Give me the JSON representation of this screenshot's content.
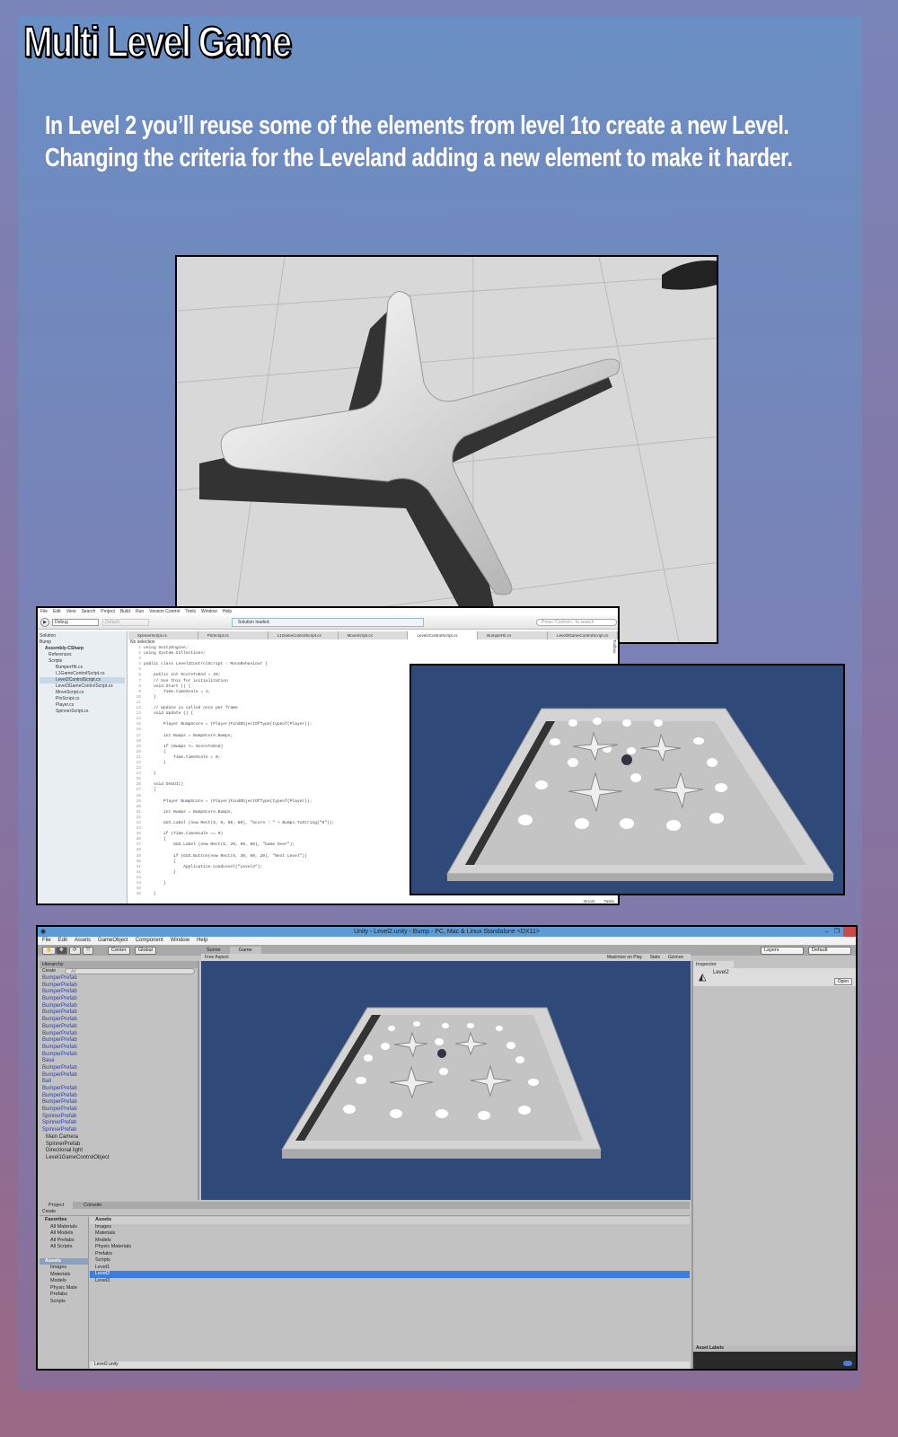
{
  "title": "Multi Level Game",
  "intro": "In Level 2 you’ll reuse some of the elements from level 1to create a new Level.  Changing the criteria for the Leveland adding a new element to make it harder.",
  "ide": {
    "menu": [
      "File",
      "Edit",
      "View",
      "Search",
      "Project",
      "Build",
      "Run",
      "Version Control",
      "Tools",
      "Window",
      "Help"
    ],
    "config": "Debug",
    "target": "Default",
    "status": "Solution loaded.",
    "search_placeholder": "Press 'Control+,' to search",
    "solution_label": "Solution",
    "no_selection": "No selection",
    "tree": [
      "Bump",
      "Assembly-CSharp",
      "References",
      "Scripts",
      "BumperHit.cs",
      "L1GameControlScript.cs",
      "Level2ControlScript.cs",
      "Level3GameControlScript.cs",
      "MoveScript.cs",
      "PinScript.cs",
      "Player.cs",
      "SpinnerScript.cs"
    ],
    "tabs": [
      "SpinnerScript.cs",
      "PinScript.cs",
      "L1GameControlScript.cs",
      "MoveScript.cs",
      "Level2ControlScript.cs",
      "BumperHit.cs",
      "Level3GameControlScript.cs"
    ],
    "side_tab": "Toolbox",
    "bottom": [
      "Errors",
      "Tasks"
    ],
    "code": [
      "using UnityEngine;",
      "using System.Collections;",
      "",
      "public class Level2ControlScript : MonoBehaviour {",
      "",
      "    public int ScoreToEnd = 20;",
      "    // Use this for initialization",
      "    void Start () {",
      "        Time.timeScale = 1;",
      "    }",
      "",
      "    // Update is called once per frame",
      "    void Update () {",
      "",
      "        Player BumpScore = (Player)FindObjectOfType(typeof(Player));",
      "",
      "        int Bumps = BumpScore.Bumps;",
      "",
      "        if (Bumps >= ScoreToEnd)",
      "        {",
      "            Time.timeScale = 0;",
      "        }",
      "",
      "    }",
      "",
      "    void OnGUI()",
      "    {",
      "",
      "        Player BumpScore = (Player)FindObjectOfType(typeof(Player));",
      "",
      "        int Bumps = BumpScore.Bumps;",
      "",
      "        GUI.Label (new Rect(5, 5, 60, 60), \"Score : \" + Bumps.ToString(\"0\"));",
      "",
      "        if (Time.timeScale == 0)",
      "        {",
      "            GUI.Label (new Rect(5, 20, 60, 60), \"Game Over\");",
      "",
      "            if (GUI.Button(new Rect(5, 30, 60, 20), \"Next Level\"))",
      "            {",
      "                Application.LoadLevel(\"Level3\");",
      "            }",
      "",
      "        }",
      "",
      "    }"
    ]
  },
  "unity": {
    "window_title": "Unity - Level2.unity - Bump - PC, Mac & Linux Standalone <DX11>",
    "menu": [
      "File",
      "Edit",
      "Assets",
      "GameObject",
      "Component",
      "Window",
      "Help"
    ],
    "pivot": "Center",
    "space": "Global",
    "layers": "Layers",
    "layout": "Default",
    "hierarchy_tab": "Hierarchy",
    "create": "Create",
    "search": "All",
    "hierarchy": [
      "BumperPrefab",
      "BumperPrefab",
      "BumperPrefab",
      "BumperPrefab",
      "BumperPrefab",
      "BumperPrefab",
      "BumperPrefab",
      "BumperPrefab",
      "BumperPrefab",
      "BumperPrefab",
      "BumperPrefab",
      "BumperPrefab",
      "Base",
      "BumperPrefab",
      "BumperPrefab",
      "Ball",
      "BumperPrefab",
      "BumperPrefab",
      "BumperPrefab",
      "BumperPrefab",
      "SpinnerPrefab",
      "SpinnerPrefab",
      "SpinnerPrefab"
    ],
    "hierarchy_plain": [
      "Main Camera",
      "SpinnerPrefab",
      "Directional light",
      "Level1GameControlObject"
    ],
    "scene_tab": "Scene",
    "game_tab": "Game",
    "aspect": "Free Aspect",
    "maximize": "Maximize on Play",
    "stats": "Stats",
    "gizmos": "Gizmos",
    "inspector_tab": "Inspector",
    "inspector_object": "Level2",
    "open": "Open",
    "asset_labels": "Asset Labels",
    "project_tab": "Project",
    "console_tab": "Console",
    "favorites": "Favorites",
    "fav_items": [
      "All Materials",
      "All Models",
      "All Prefabs",
      "All Scripts"
    ],
    "assets_root": "Assets",
    "asset_folders": [
      "Images",
      "Materials",
      "Models",
      "Physic Mate",
      "Prefabs",
      "Scripts"
    ],
    "assets_list": [
      "Images",
      "Materials",
      "Models",
      "Physic Materials",
      "Prefabs",
      "Scripts",
      "Level1",
      "Level2",
      "Level3"
    ],
    "selected_asset": "Level2",
    "footer": "Level2.unity"
  }
}
